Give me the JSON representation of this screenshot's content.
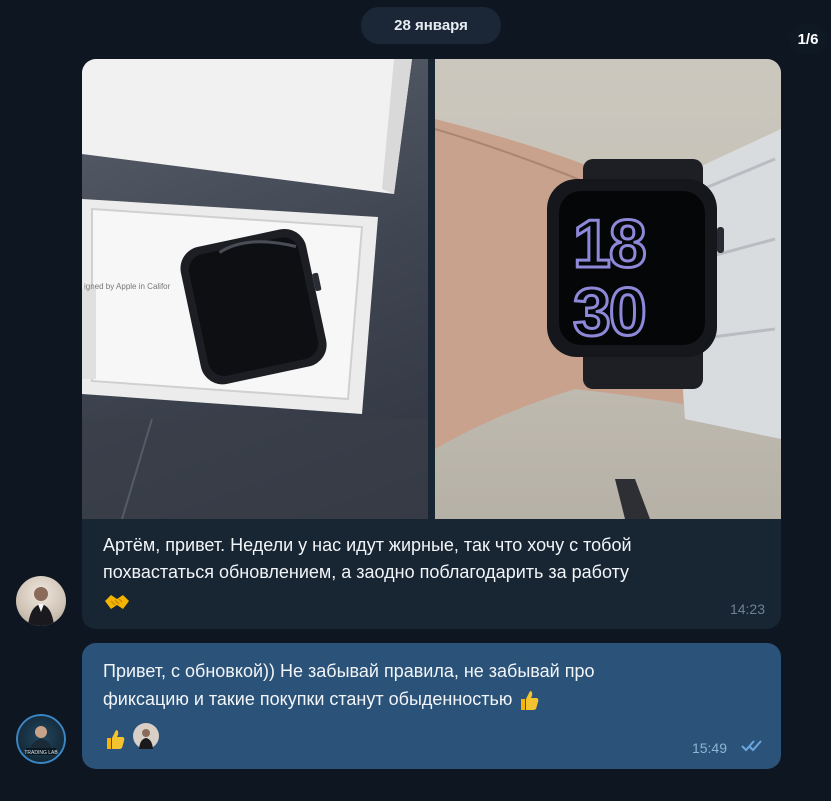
{
  "header": {
    "date_label": "28 января",
    "photo_counter": "1/6"
  },
  "incoming_message": {
    "line1": "Артём, привет. Недели у нас идут жирные, так что хочу с тобой",
    "line2": "похвастаться обновлением, а заодно поблагодарить за работу",
    "emoji": "handshake-emoji",
    "time": "14:23",
    "watch_time_top": "18",
    "watch_time_bottom": "30"
  },
  "outgoing_message": {
    "line1": "Привет, с обновкой)) Не забывай правила, не забывай про",
    "line2": "фиксацию и такие покупки станут обыденностью",
    "emoji": "thumbs-up-emoji",
    "time": "15:49",
    "read_status": "double-check-icon",
    "reactions": [
      "thumbs-up-emoji",
      "reactor-avatar"
    ]
  },
  "colors": {
    "background": "#0e1621",
    "incoming_bubble": "#182533",
    "outgoing_bubble": "#2b5278",
    "watch_digits": "#8e88d8"
  }
}
